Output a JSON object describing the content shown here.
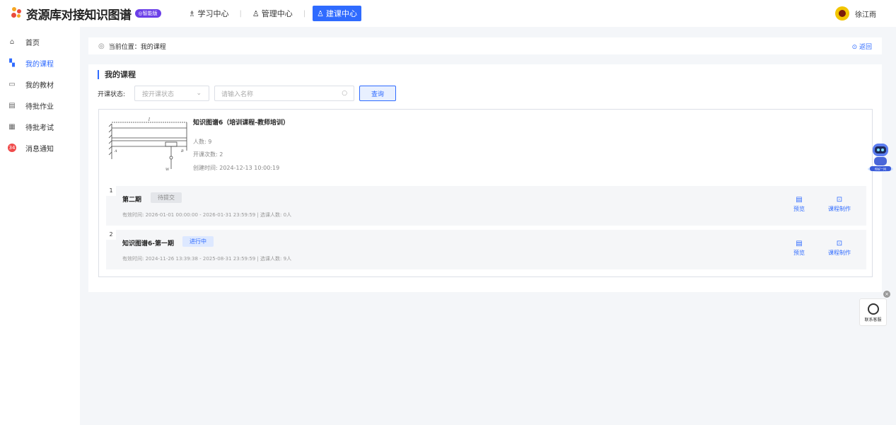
{
  "header": {
    "app_title": "资源库对接知识图谱",
    "ai_badge": "◎智能版",
    "nav": [
      {
        "label": "学习中心",
        "icon": "graduation-icon"
      },
      {
        "label": "管理中心",
        "icon": "users-icon"
      },
      {
        "label": "建课中心",
        "icon": "build-course-icon",
        "active": true
      }
    ],
    "user_name": "徐江雨"
  },
  "sidebar": {
    "items": [
      {
        "label": "首页",
        "icon": "home-icon"
      },
      {
        "label": "我的课程",
        "icon": "book-icon",
        "active": true
      },
      {
        "label": "我的教材",
        "icon": "textbook-icon"
      },
      {
        "label": "待批作业",
        "icon": "homework-icon"
      },
      {
        "label": "待批考试",
        "icon": "exam-icon"
      },
      {
        "label": "消息通知",
        "icon": "bell-icon",
        "badge": "34"
      }
    ]
  },
  "breadcrumb": {
    "text": "当前位置：我的课程",
    "back_label": "返回"
  },
  "section": {
    "title": "我的课程",
    "filter_label": "开课状态:",
    "select_placeholder": "按开课状态",
    "search_placeholder": "请输入名称",
    "query_label": "查询"
  },
  "course": {
    "name": "知识图谱6（培训课程-教师培训）",
    "people": "人数: 9",
    "sessions": "开课次数: 2",
    "created": "创建时间: 2024-12-13 10:00:19",
    "diagram_labels": {
      "l": "l",
      "a": "A",
      "b": "B",
      "w": "W"
    },
    "periods": [
      {
        "index": "1",
        "name": "第二期",
        "status": "待提交",
        "status_kind": "wait",
        "info": "有效时间: 2026-01-01 00:00:00 - 2026-01-31 23:59:59  |  选课人数: 0人",
        "preview": "预览",
        "make": "课程制作"
      },
      {
        "index": "2",
        "name": "知识图谱6-第一期",
        "status": "进行中",
        "status_kind": "run",
        "info": "有效时间: 2024-11-26 13:39:38 - 2025-08-31 23:59:59  |  选课人数: 9人",
        "preview": "预览",
        "make": "课程制作"
      }
    ]
  },
  "robot_label": "你好一问",
  "service_label": "联系客服",
  "colors": {
    "accent": "#2f6bff",
    "ai_badge": "#6b3fe8",
    "alert": "#f04a4a"
  }
}
